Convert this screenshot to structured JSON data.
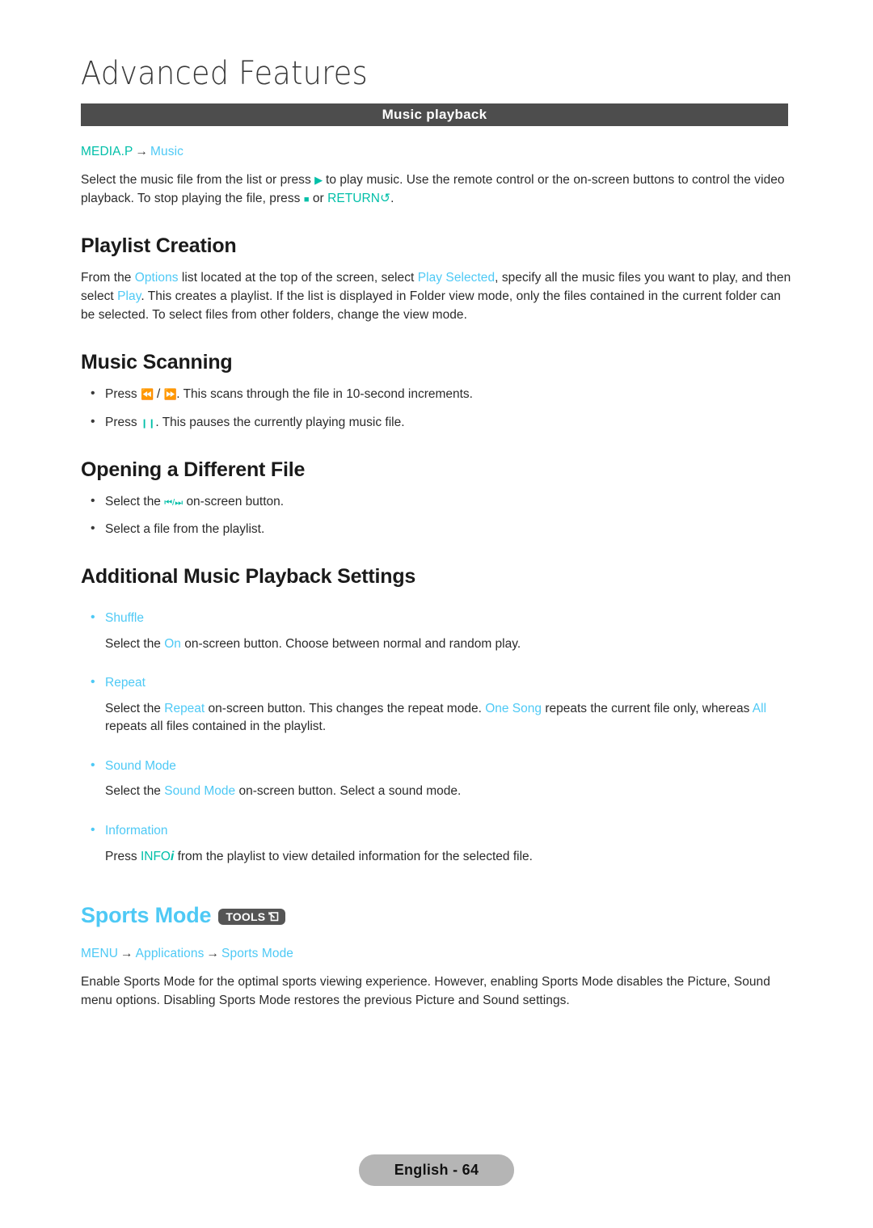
{
  "page": {
    "chapter_title": "Advanced Features",
    "banner_label": "Music playback",
    "footer_label": "English - 64",
    "colors": {
      "cyan": "#4ec9f5",
      "teal": "#00bfa8",
      "banner_bg": "#4d4d4d",
      "footer_bg": "#b5b5b5",
      "badge_bg": "#555555",
      "body_text": "#2b2b2b"
    }
  },
  "media_path": {
    "root": "MEDIA.P",
    "arrow": "→",
    "target": "Music"
  },
  "intro": {
    "part1": "Select the music file from the list or press",
    "play_icon": "▶",
    "part2": "to play music. Use the remote control or the on-screen buttons to control the video playback. To stop playing the file, press",
    "stop_icon": "■",
    "part3": "or",
    "return_label": "RETURN",
    "return_icon": "↺",
    "part4": "."
  },
  "sections": [
    {
      "id": "playlist-creation",
      "heading": "Playlist Creation",
      "paragraph": {
        "t1": "From the ",
        "k1": "Options",
        "t2": " list located at the top of the screen, select ",
        "k2": "Play Selected",
        "t3": ", specify all the music files you want to play, and then select ",
        "k3": "Play",
        "t4": ". This creates a playlist. If the list is displayed in Folder view mode, only the files contained in the current folder can be selected. To select files from other folders, change the view mode."
      }
    },
    {
      "id": "music-scanning",
      "heading": "Music Scanning",
      "bullets": [
        {
          "pre": "Press",
          "icon_a": "⏪",
          "sep": "/",
          "icon_b": "⏩",
          "post": ". This scans through the file in 10-second increments."
        },
        {
          "pre": "Press",
          "icon_a": "❙❙",
          "post": ". This pauses the currently playing music file."
        }
      ]
    },
    {
      "id": "opening-different-file",
      "heading": "Opening a Different File",
      "bullets": [
        {
          "pre": "Select the",
          "icon_a": "⏮",
          "sep": "/",
          "icon_b": "⏭",
          "post": "on-screen button."
        },
        {
          "plain": "Select a file from the playlist."
        }
      ]
    }
  ],
  "additional_settings": {
    "heading": "Additional Music Playback Settings",
    "items": [
      {
        "label": "Shuffle",
        "desc": {
          "t1": "Select the ",
          "k1": "On",
          "t2": " on-screen button. Choose between normal and random play."
        }
      },
      {
        "label": "Repeat",
        "desc": {
          "t1": "Select the ",
          "k1": "Repeat",
          "t2": " on-screen button. This changes the repeat mode. ",
          "k2": "One Song",
          "t3": " repeats the current file only, whereas ",
          "k3": "All",
          "t4": " repeats all files contained in the playlist."
        }
      },
      {
        "label": "Sound Mode",
        "desc": {
          "t1": "Select the ",
          "k1": "Sound Mode",
          "t2": " on-screen button. Select a sound mode."
        }
      },
      {
        "label": "Information",
        "desc": {
          "t1": "Press ",
          "k1": "INFO",
          "icon": "i",
          "t2": " from the playlist to view detailed information for the selected file."
        }
      }
    ]
  },
  "sports_mode": {
    "heading": "Sports Mode",
    "badge_label": "TOOLS",
    "menu_path": {
      "p1": "MENU",
      "arrow1": "→",
      "p2": "Applications",
      "arrow2": "→",
      "p3": "Sports Mode"
    },
    "paragraph": "Enable Sports Mode for the optimal sports viewing experience. However, enabling Sports Mode disables the Picture, Sound menu options. Disabling Sports Mode restores the previous Picture and Sound settings."
  }
}
